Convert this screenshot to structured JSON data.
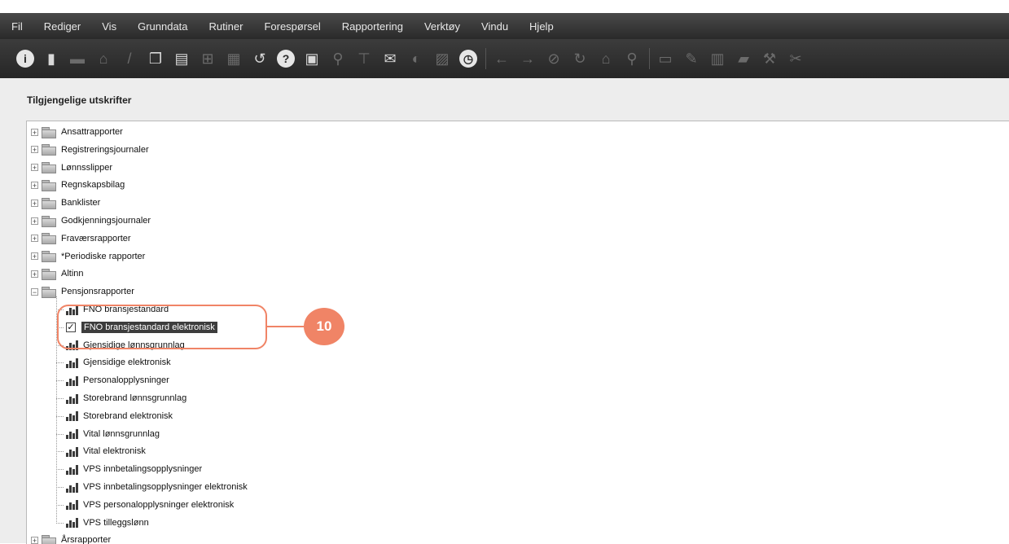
{
  "menu": [
    "Fil",
    "Rediger",
    "Vis",
    "Grunndata",
    "Rutiner",
    "Forespørsel",
    "Rapportering",
    "Verktøy",
    "Vindu",
    "Hjelp"
  ],
  "toolbar_icons": [
    {
      "name": "info-icon",
      "glyph": "i",
      "style": "round"
    },
    {
      "name": "new-document-icon",
      "glyph": "▮",
      "style": ""
    },
    {
      "name": "save-icon",
      "glyph": "▬",
      "style": "dim"
    },
    {
      "name": "delete-icon",
      "glyph": "⌂",
      "style": "dim"
    },
    {
      "name": "edit-icon",
      "glyph": "/",
      "style": "dim"
    },
    {
      "name": "copy-icon",
      "glyph": "❐",
      "style": ""
    },
    {
      "name": "paste-icon",
      "glyph": "▤",
      "style": ""
    },
    {
      "name": "import-icon",
      "glyph": "⊞",
      "style": "dim"
    },
    {
      "name": "export-icon",
      "glyph": "▦",
      "style": "dim"
    },
    {
      "name": "refresh-icon",
      "glyph": "↺",
      "style": ""
    },
    {
      "name": "help-icon",
      "glyph": "?",
      "style": "round"
    },
    {
      "name": "print-preview-icon",
      "glyph": "▣",
      "style": ""
    },
    {
      "name": "search-icon",
      "glyph": "⚲",
      "style": "dim"
    },
    {
      "name": "filter-icon",
      "glyph": "⊤",
      "style": "dim"
    },
    {
      "name": "mail-icon",
      "glyph": "✉",
      "style": ""
    },
    {
      "name": "globe-icon",
      "glyph": "◐",
      "style": "dim"
    },
    {
      "name": "chart-icon",
      "glyph": "▨",
      "style": "dim"
    },
    {
      "name": "clock-icon",
      "glyph": "◷",
      "style": "round"
    },
    {
      "name": "back-icon",
      "glyph": "←",
      "style": "dim"
    },
    {
      "name": "forward-icon",
      "glyph": "→",
      "style": "dim"
    },
    {
      "name": "stop-icon",
      "glyph": "⊘",
      "style": "dim"
    },
    {
      "name": "reload-icon",
      "glyph": "↻",
      "style": "dim"
    },
    {
      "name": "home-icon",
      "glyph": "⌂",
      "style": "dim"
    },
    {
      "name": "find-icon",
      "glyph": "⚲",
      "style": "dim"
    },
    {
      "name": "folder-icon",
      "glyph": "▭",
      "style": "dim"
    },
    {
      "name": "signature-icon",
      "glyph": "✎",
      "style": "dim"
    },
    {
      "name": "report-icon",
      "glyph": "▥",
      "style": "dim"
    },
    {
      "name": "network-icon",
      "glyph": "▰",
      "style": "dim"
    },
    {
      "name": "tools-icon",
      "glyph": "⚒",
      "style": "dim"
    },
    {
      "name": "scissors-icon",
      "glyph": "✂",
      "style": "dim"
    }
  ],
  "panel": {
    "title": "Tilgjengelige utskrifter"
  },
  "tree": {
    "folders_top": [
      "Ansattrapporter",
      "Registreringsjournaler",
      "Lønnsslipper",
      "Regnskapsbilag",
      "Banklister",
      "Godkjenningsjournaler",
      "Fraværsrapporter",
      "*Periodiske rapporter",
      "Altinn"
    ],
    "expanded_folder": "Pensjonsrapporter",
    "children": [
      {
        "label": "FNO bransjestandard",
        "checked": false
      },
      {
        "label": "FNO bransjestandard elektronisk",
        "checked": true
      },
      {
        "label": "Gjensidige  lønnsgrunnlag",
        "checked": false
      },
      {
        "label": "Gjensidige elektronisk",
        "checked": false
      },
      {
        "label": "Personalopplysninger",
        "checked": false
      },
      {
        "label": "Storebrand  lønnsgrunnlag",
        "checked": false
      },
      {
        "label": "Storebrand elektronisk",
        "checked": false
      },
      {
        "label": "Vital lønnsgrunnlag",
        "checked": false
      },
      {
        "label": "Vital elektronisk",
        "checked": false
      },
      {
        "label": "VPS innbetalingsopplysninger",
        "checked": false
      },
      {
        "label": "VPS innbetalingsopplysninger elektronisk",
        "checked": false
      },
      {
        "label": "VPS personalopplysninger elektronisk",
        "checked": false
      },
      {
        "label": "VPS tilleggslønn",
        "checked": false
      }
    ],
    "folders_bottom": [
      "Årsrapporter"
    ]
  },
  "callout": {
    "number": "10",
    "color": "#f08466"
  }
}
